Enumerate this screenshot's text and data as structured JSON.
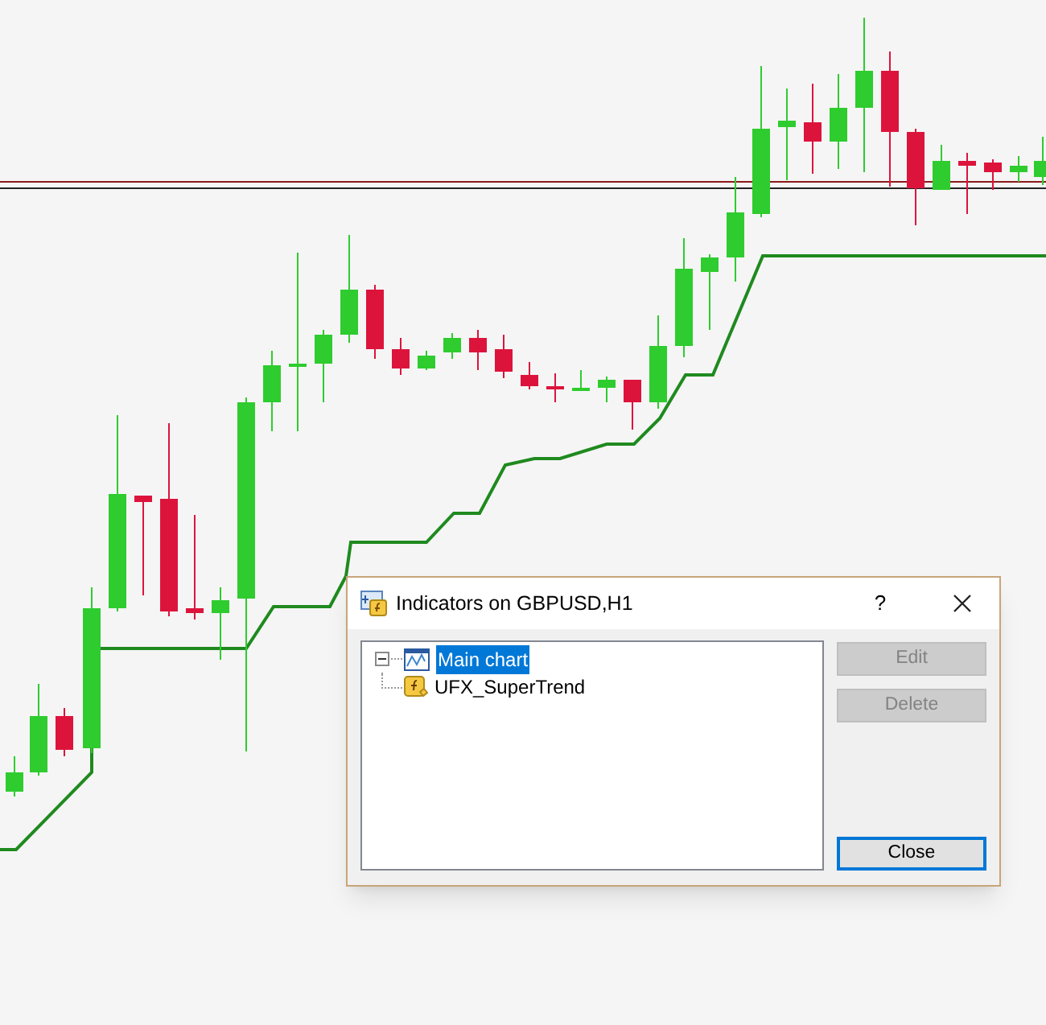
{
  "dialog": {
    "title": "Indicators on GBPUSD,H1",
    "help": "?",
    "tree": [
      {
        "label": "Main chart",
        "selected": true,
        "expanded": true,
        "children": [
          {
            "label": "UFX_SuperTrend",
            "selected": false
          }
        ]
      }
    ],
    "buttons": [
      {
        "label": "Edit",
        "disabled": true,
        "focused": false
      },
      {
        "label": "Delete",
        "disabled": true,
        "focused": false
      },
      {
        "label": "Close",
        "disabled": false,
        "focused": true
      }
    ]
  }
}
